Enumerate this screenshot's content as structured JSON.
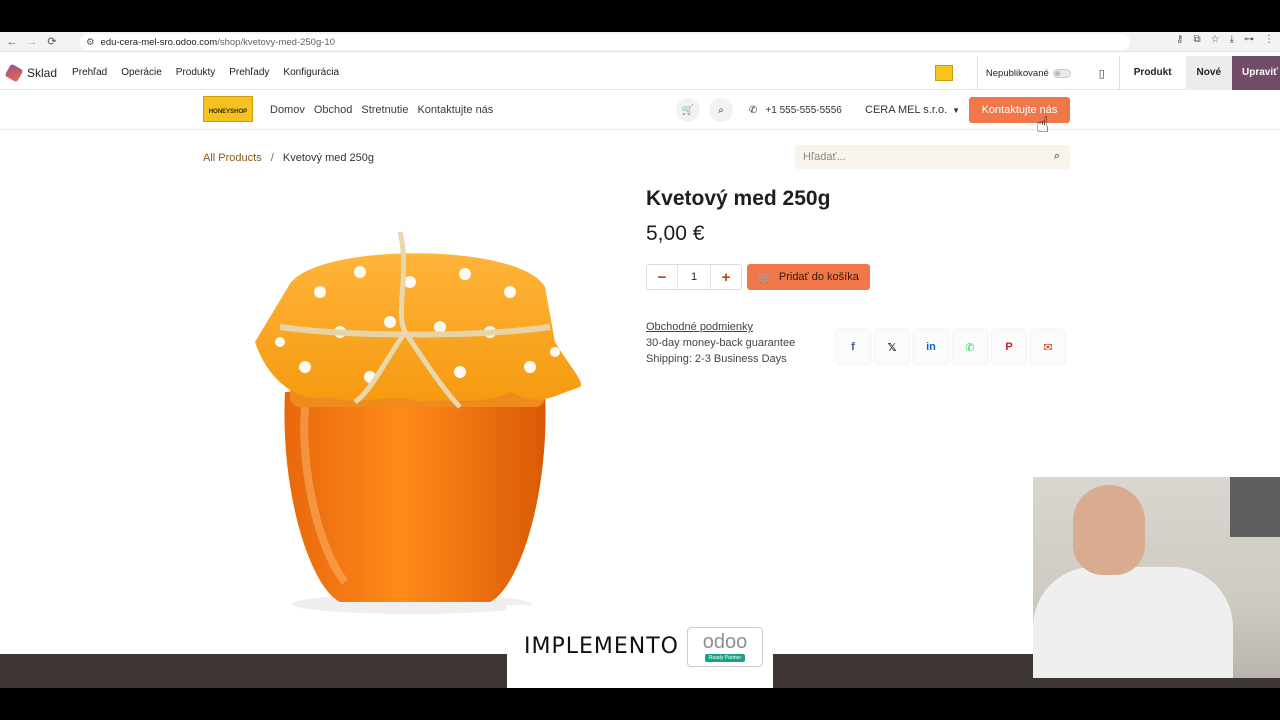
{
  "browser": {
    "url_host": "edu-cera-mel-sro.odoo.com",
    "url_path": "/shop/kvetovy-med-250g-10"
  },
  "odoo_bar": {
    "app_name": "Sklad",
    "menu": [
      "Prehľad",
      "Operácie",
      "Produkty",
      "Prehľady",
      "Konfigurácia"
    ],
    "publish_label": "Nepublikované",
    "produkt_label": "Produkt",
    "nove_label": "Nové",
    "upravit_label": "Upraviť"
  },
  "site": {
    "logo_text": "HONEYSHOP",
    "nav": [
      "Domov",
      "Obchod",
      "Stretnutie",
      "Kontaktujte nás"
    ],
    "phone": "+1 555-555-5556",
    "company": "CERA MEL s.r.o.",
    "contact_button": "Kontaktujte nás"
  },
  "product": {
    "breadcrumb_root": "All Products",
    "breadcrumb_separator": "/",
    "breadcrumb_current": "Kvetový med 250g",
    "search_placeholder": "Hľadať...",
    "title": "Kvetový med 250g",
    "price": "5,00 €",
    "quantity": "1",
    "cart_button": "Pridať do košíka",
    "terms_link": "Obchodné podmienky",
    "guarantee": "30-day money-back guarantee",
    "shipping": "Shipping: 2-3 Business Days"
  },
  "branding": {
    "implemento": "IMPLEMENTO",
    "odoo": "odoo",
    "partner": "Ready Partner"
  },
  "colors": {
    "accent_orange": "#f0774a",
    "odoo_purple": "#714b67",
    "breadcrumb_brown": "#8a5a12"
  }
}
